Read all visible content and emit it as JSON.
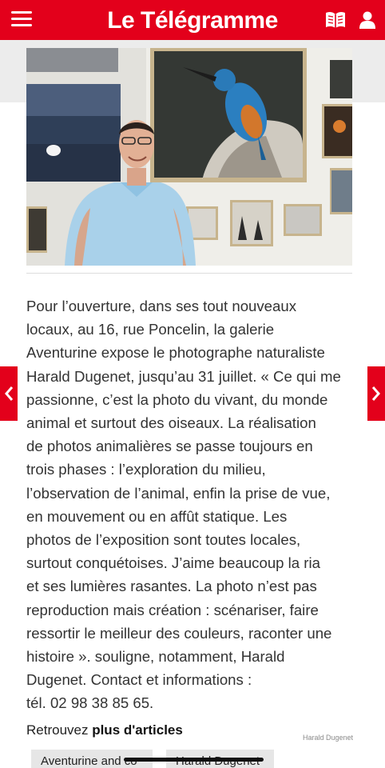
{
  "header": {
    "logo_text": "Le Télégramme",
    "background_color": "#e3001b",
    "menu_icon": "hamburger-menu-icon",
    "edition_icon": "open-book-icon",
    "account_icon": "user-icon"
  },
  "photo": {
    "description_icon": "article-photo",
    "credit": "Harald Dugenet"
  },
  "article": {
    "lines": [
      "Pour l’ouverture, dans ses tout nouveaux",
      "locaux, au 16, rue Poncelin, la galerie",
      "Aventurine expose le photographe naturaliste",
      "Harald Dugenet, jusqu’au 31 juillet. « Ce qui me",
      "passionne, c’est la photo du vivant, du monde",
      "animal et surtout des oiseaux. La réalisation",
      "de photos animalières se passe toujours en",
      "trois phases : l’exploration du milieu,",
      "l’observation de l’animal, enfin la prise de vue,",
      "en mouvement ou en affût statique. Les",
      "photos de l’exposition sont toutes locales,",
      "surtout conquétoises. J’aime beaucoup la ria",
      "et ses lumières rasantes. La photo n’est pas",
      "reproduction mais création : scénariser, faire",
      "ressortir le meilleur des couleurs, raconter une",
      "histoire ». souligne, notamment, Harald",
      "Dugenet. Contact et informations :",
      "tél. 02 98 38 85 65."
    ]
  },
  "navigation": {
    "prev_icon": "chevron-left-icon",
    "next_icon": "chevron-right-icon"
  },
  "more_articles": {
    "prefix": "Retrouvez ",
    "bold": "plus d'articles",
    "tags": [
      "Aventurine and co",
      "Harald Dugenet"
    ]
  }
}
